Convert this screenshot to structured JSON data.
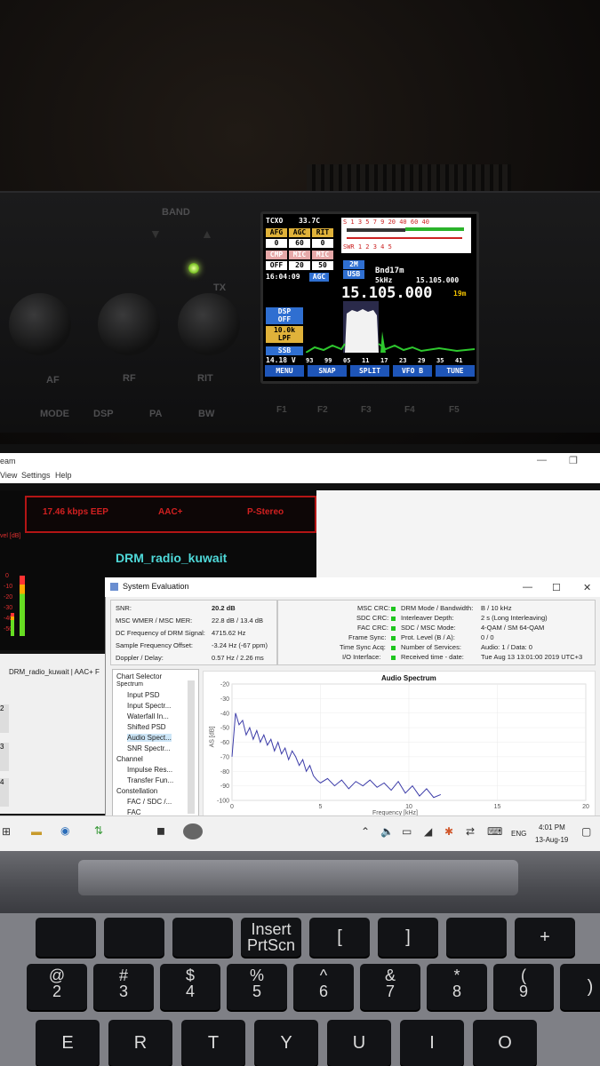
{
  "radio": {
    "band_label": "BAND",
    "tx_label": "TX",
    "bottom_labels": [
      "MODE",
      "DSP",
      "PA",
      "BW"
    ],
    "mid_labels": [
      "AF",
      "RF",
      "RIT"
    ],
    "f_keys": [
      "F1",
      "F2",
      "F3",
      "F4",
      "F5"
    ],
    "lcd": {
      "tcxo": "TCXO",
      "temp": "33.7C",
      "top_labels": [
        "AFG",
        "AGC",
        "RIT"
      ],
      "top_values": [
        "0",
        "60",
        "0"
      ],
      "mid_labels": [
        "CMP",
        "MIC",
        "MIC"
      ],
      "mid_values": [
        "OFF",
        "20",
        "50"
      ],
      "scale_top": "S 1 3 5 7 9 20 40 60 40",
      "scale_bottom": "SWR 1 2 3 4 5",
      "mode_2m": "2M",
      "time": "16:04:09",
      "agc": "AGC",
      "usb": "USB",
      "step": "5kHz",
      "band": "Bnd17m",
      "vfo_b": "15.105.000",
      "main_freq": "15.105.000",
      "band_small": "19m",
      "dsp": "DSP",
      "dsp_state": "OFF",
      "bw": "10.0k",
      "lpf": "LPF",
      "ssb": "SSB",
      "voltage": "14.18 V",
      "scale_nums": [
        "93",
        "99",
        "05",
        "11",
        "17",
        "23",
        "29",
        "35",
        "41"
      ],
      "softkeys": [
        "MENU",
        "SNAP",
        "SPLIT",
        "VFO B",
        "TUNE"
      ]
    }
  },
  "dream": {
    "title_fragment": "eam",
    "menu": [
      "View",
      "Settings",
      "Help"
    ],
    "bitrate": "17.46 kbps EEP",
    "codec": "AAC+",
    "stereo": "P-Stereo",
    "station": "DRM_radio_kuwait",
    "level_label": "vel [dB]",
    "level_ticks": [
      "0",
      "-10",
      "-20",
      "-30",
      "-40",
      "-50"
    ],
    "tab_row": "DRM_radio_kuwait  |  AAC+ F",
    "row_nums": [
      "2",
      "3",
      "4"
    ]
  },
  "system_eval": {
    "title": "System Evaluation",
    "left_rows": [
      {
        "label": "SNR:",
        "value": "20.2 dB"
      },
      {
        "label": "MSC WMER / MSC MER:",
        "value": "22.8 dB / 13.4 dB"
      },
      {
        "label": "DC Frequency of DRM Signal:",
        "value": "4715.62 Hz"
      },
      {
        "label": "Sample Frequency Offset:",
        "value": "-3.24 Hz (-67 ppm)"
      },
      {
        "label": "Doppler / Delay:",
        "value": "0.57 Hz / 2.26 ms"
      }
    ],
    "crc_rows": [
      "MSC CRC:",
      "SDC CRC:",
      "FAC CRC:",
      "Frame Sync:",
      "Time Sync Acq:",
      "I/O Interface:"
    ],
    "right_rows": [
      {
        "label": "DRM Mode / Bandwidth:",
        "value": "B / 10 kHz"
      },
      {
        "label": "Interleaver Depth:",
        "value": "2 s (Long Interleaving)"
      },
      {
        "label": "SDC / MSC Mode:",
        "value": "4-QAM / SM 64-QAM"
      },
      {
        "label": "Prot. Level (B / A):",
        "value": "0 / 0"
      },
      {
        "label": "Number of Services:",
        "value": "Audio: 1 / Data: 0"
      },
      {
        "label": "Received time - date:",
        "value": "Tue Aug 13 13:01:00 2019 UTC+3"
      }
    ],
    "chart_selector": "Chart Selector",
    "tree": [
      "Spectrum",
      "Input PSD",
      "Input Spectr...",
      "Waterfall In...",
      "Shifted PSD",
      "Audio Spect...",
      "SNR Spectr...",
      "Channel",
      "Impulse Res...",
      "Transfer Fun...",
      "Constellation",
      "FAC / SDC /...",
      "FAC"
    ]
  },
  "chart_data": {
    "type": "line",
    "title": "Audio Spectrum",
    "xlabel": "Frequency [kHz]",
    "ylabel": "AS [dB]",
    "xlim": [
      0,
      20
    ],
    "ylim": [
      -100,
      -20
    ],
    "x_ticks": [
      "0",
      "5",
      "10",
      "15",
      "20"
    ],
    "y_ticks": [
      "-20",
      "-30",
      "-40",
      "-50",
      "-60",
      "-70",
      "-80",
      "-90",
      "-100"
    ],
    "series": [
      {
        "x": [
          0,
          0.2,
          0.4,
          0.6,
          0.8,
          1.0,
          1.2,
          1.4,
          1.6,
          1.8,
          2.0,
          2.2,
          2.4,
          2.6,
          2.8,
          3.0,
          3.2,
          3.4,
          3.6,
          3.8,
          4.0,
          4.2,
          4.4,
          4.6,
          4.8,
          5.0,
          5.4,
          5.8,
          6.2,
          6.6,
          7.0,
          7.4,
          7.8,
          8.2,
          8.6,
          9.0,
          9.4,
          9.8,
          10.2,
          10.6,
          11.0,
          11.4,
          11.8
        ],
        "values": [
          -70,
          -40,
          -48,
          -45,
          -55,
          -50,
          -58,
          -52,
          -60,
          -55,
          -62,
          -58,
          -66,
          -60,
          -68,
          -64,
          -72,
          -66,
          -70,
          -76,
          -72,
          -80,
          -76,
          -83,
          -86,
          -88,
          -85,
          -90,
          -86,
          -92,
          -87,
          -90,
          -86,
          -91,
          -88,
          -93,
          -87,
          -95,
          -90,
          -97,
          -92,
          -98,
          -96
        ]
      }
    ]
  },
  "taskbar": {
    "lang": "ENG",
    "time": "4:01 PM",
    "date": "13-Aug-19"
  },
  "keyboard": {
    "row1": [
      "",
      "",
      "",
      "Insert\nPrtScn",
      "[",
      "]",
      "",
      "+"
    ],
    "row2": [
      "@\n2",
      "#\n3",
      "$\n4",
      "%\n5",
      "^\n6",
      "&\n7",
      "*\n8",
      "(\n9",
      ")"
    ],
    "row3": [
      "E",
      "R",
      "T",
      "Y",
      "U",
      "I",
      "O"
    ]
  }
}
